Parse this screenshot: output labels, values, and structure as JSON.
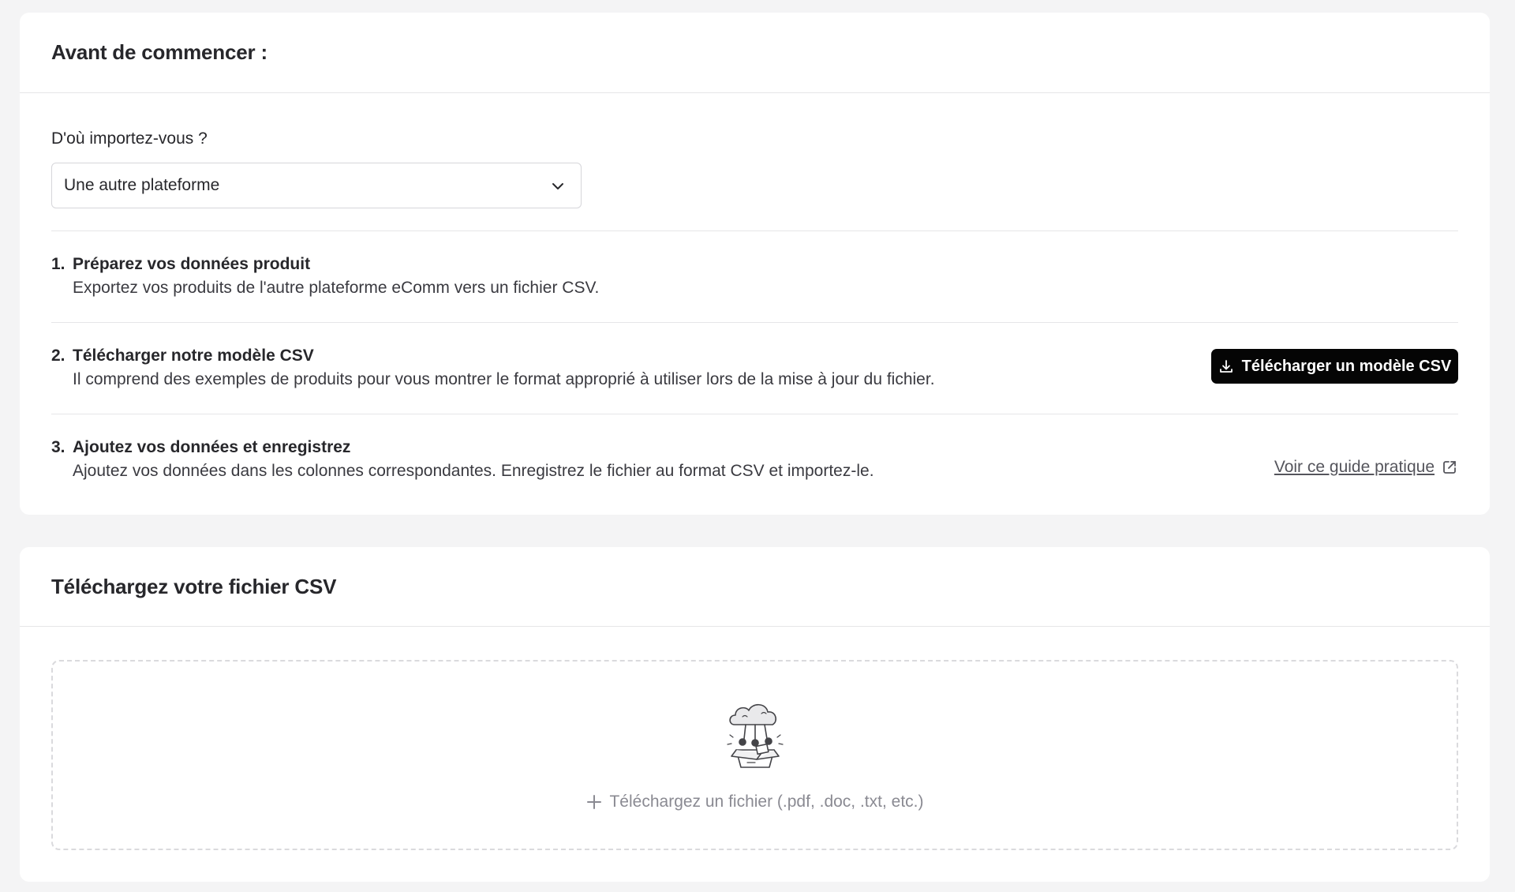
{
  "before_start": {
    "title": "Avant de commencer :",
    "source_label": "D'où importez-vous ?",
    "source_value": "Une autre plateforme",
    "steps": [
      {
        "number": "1.",
        "title": "Préparez vos données produit",
        "description": "Exportez vos produits de l'autre plateforme eComm vers un fichier CSV."
      },
      {
        "number": "2.",
        "title": "Télécharger notre modèle CSV",
        "description": "Il comprend des exemples de produits pour vous montrer le format approprié à utiliser lors de la mise à jour du fichier.",
        "action_label": "Télécharger un modèle CSV"
      },
      {
        "number": "3.",
        "title": "Ajoutez vos données et enregistrez",
        "description": "Ajoutez vos données dans les colonnes correspondantes. Enregistrez le fichier au format CSV et importez-le.",
        "link_label": "Voir ce guide pratique"
      }
    ]
  },
  "upload": {
    "title": "Téléchargez votre fichier CSV",
    "dropzone_hint": "Téléchargez un fichier (.pdf, .doc, .txt, etc.)"
  },
  "icons": {
    "select_chevron": "chevron-down-icon",
    "download": "download-icon",
    "external_link": "external-link-icon",
    "plus": "plus-icon",
    "illustration": "cloud-upload-box-illustration"
  },
  "colors": {
    "primary_button_bg": "#050505",
    "page_bg": "#f4f4f5",
    "card_bg": "#ffffff"
  }
}
